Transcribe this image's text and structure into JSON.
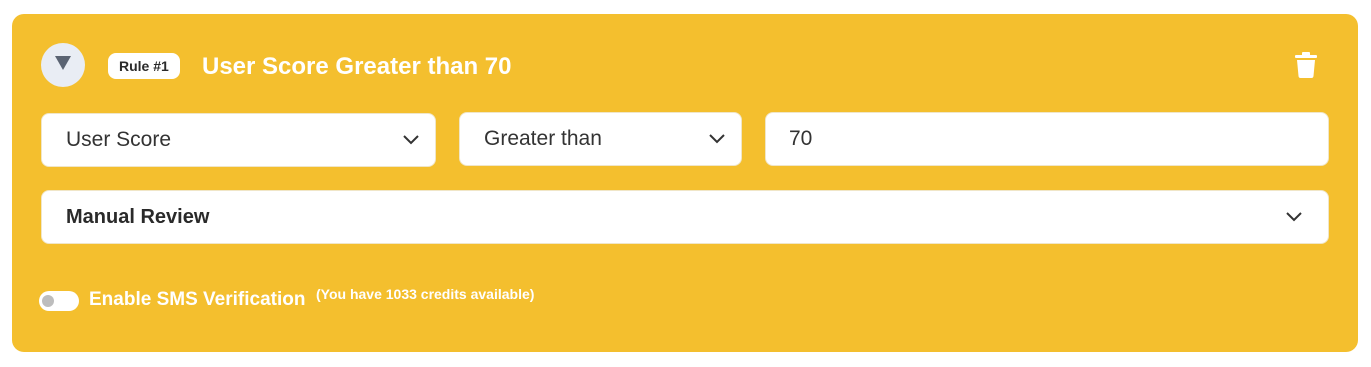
{
  "rule": {
    "badge": "Rule #1",
    "title": "User Score Greater than 70",
    "collapse_icon": "triangle-down-icon",
    "delete_icon": "trash-icon"
  },
  "condition": {
    "field_value": "User Score",
    "operator_value": "Greater than",
    "threshold_value": "70"
  },
  "action": {
    "value": "Manual Review"
  },
  "sms": {
    "label": "Enable SMS Verification",
    "note": "(You have 1033 credits available)",
    "enabled": false
  },
  "colors": {
    "card_background": "#f4bf2e",
    "text_on_card": "#ffffff"
  }
}
